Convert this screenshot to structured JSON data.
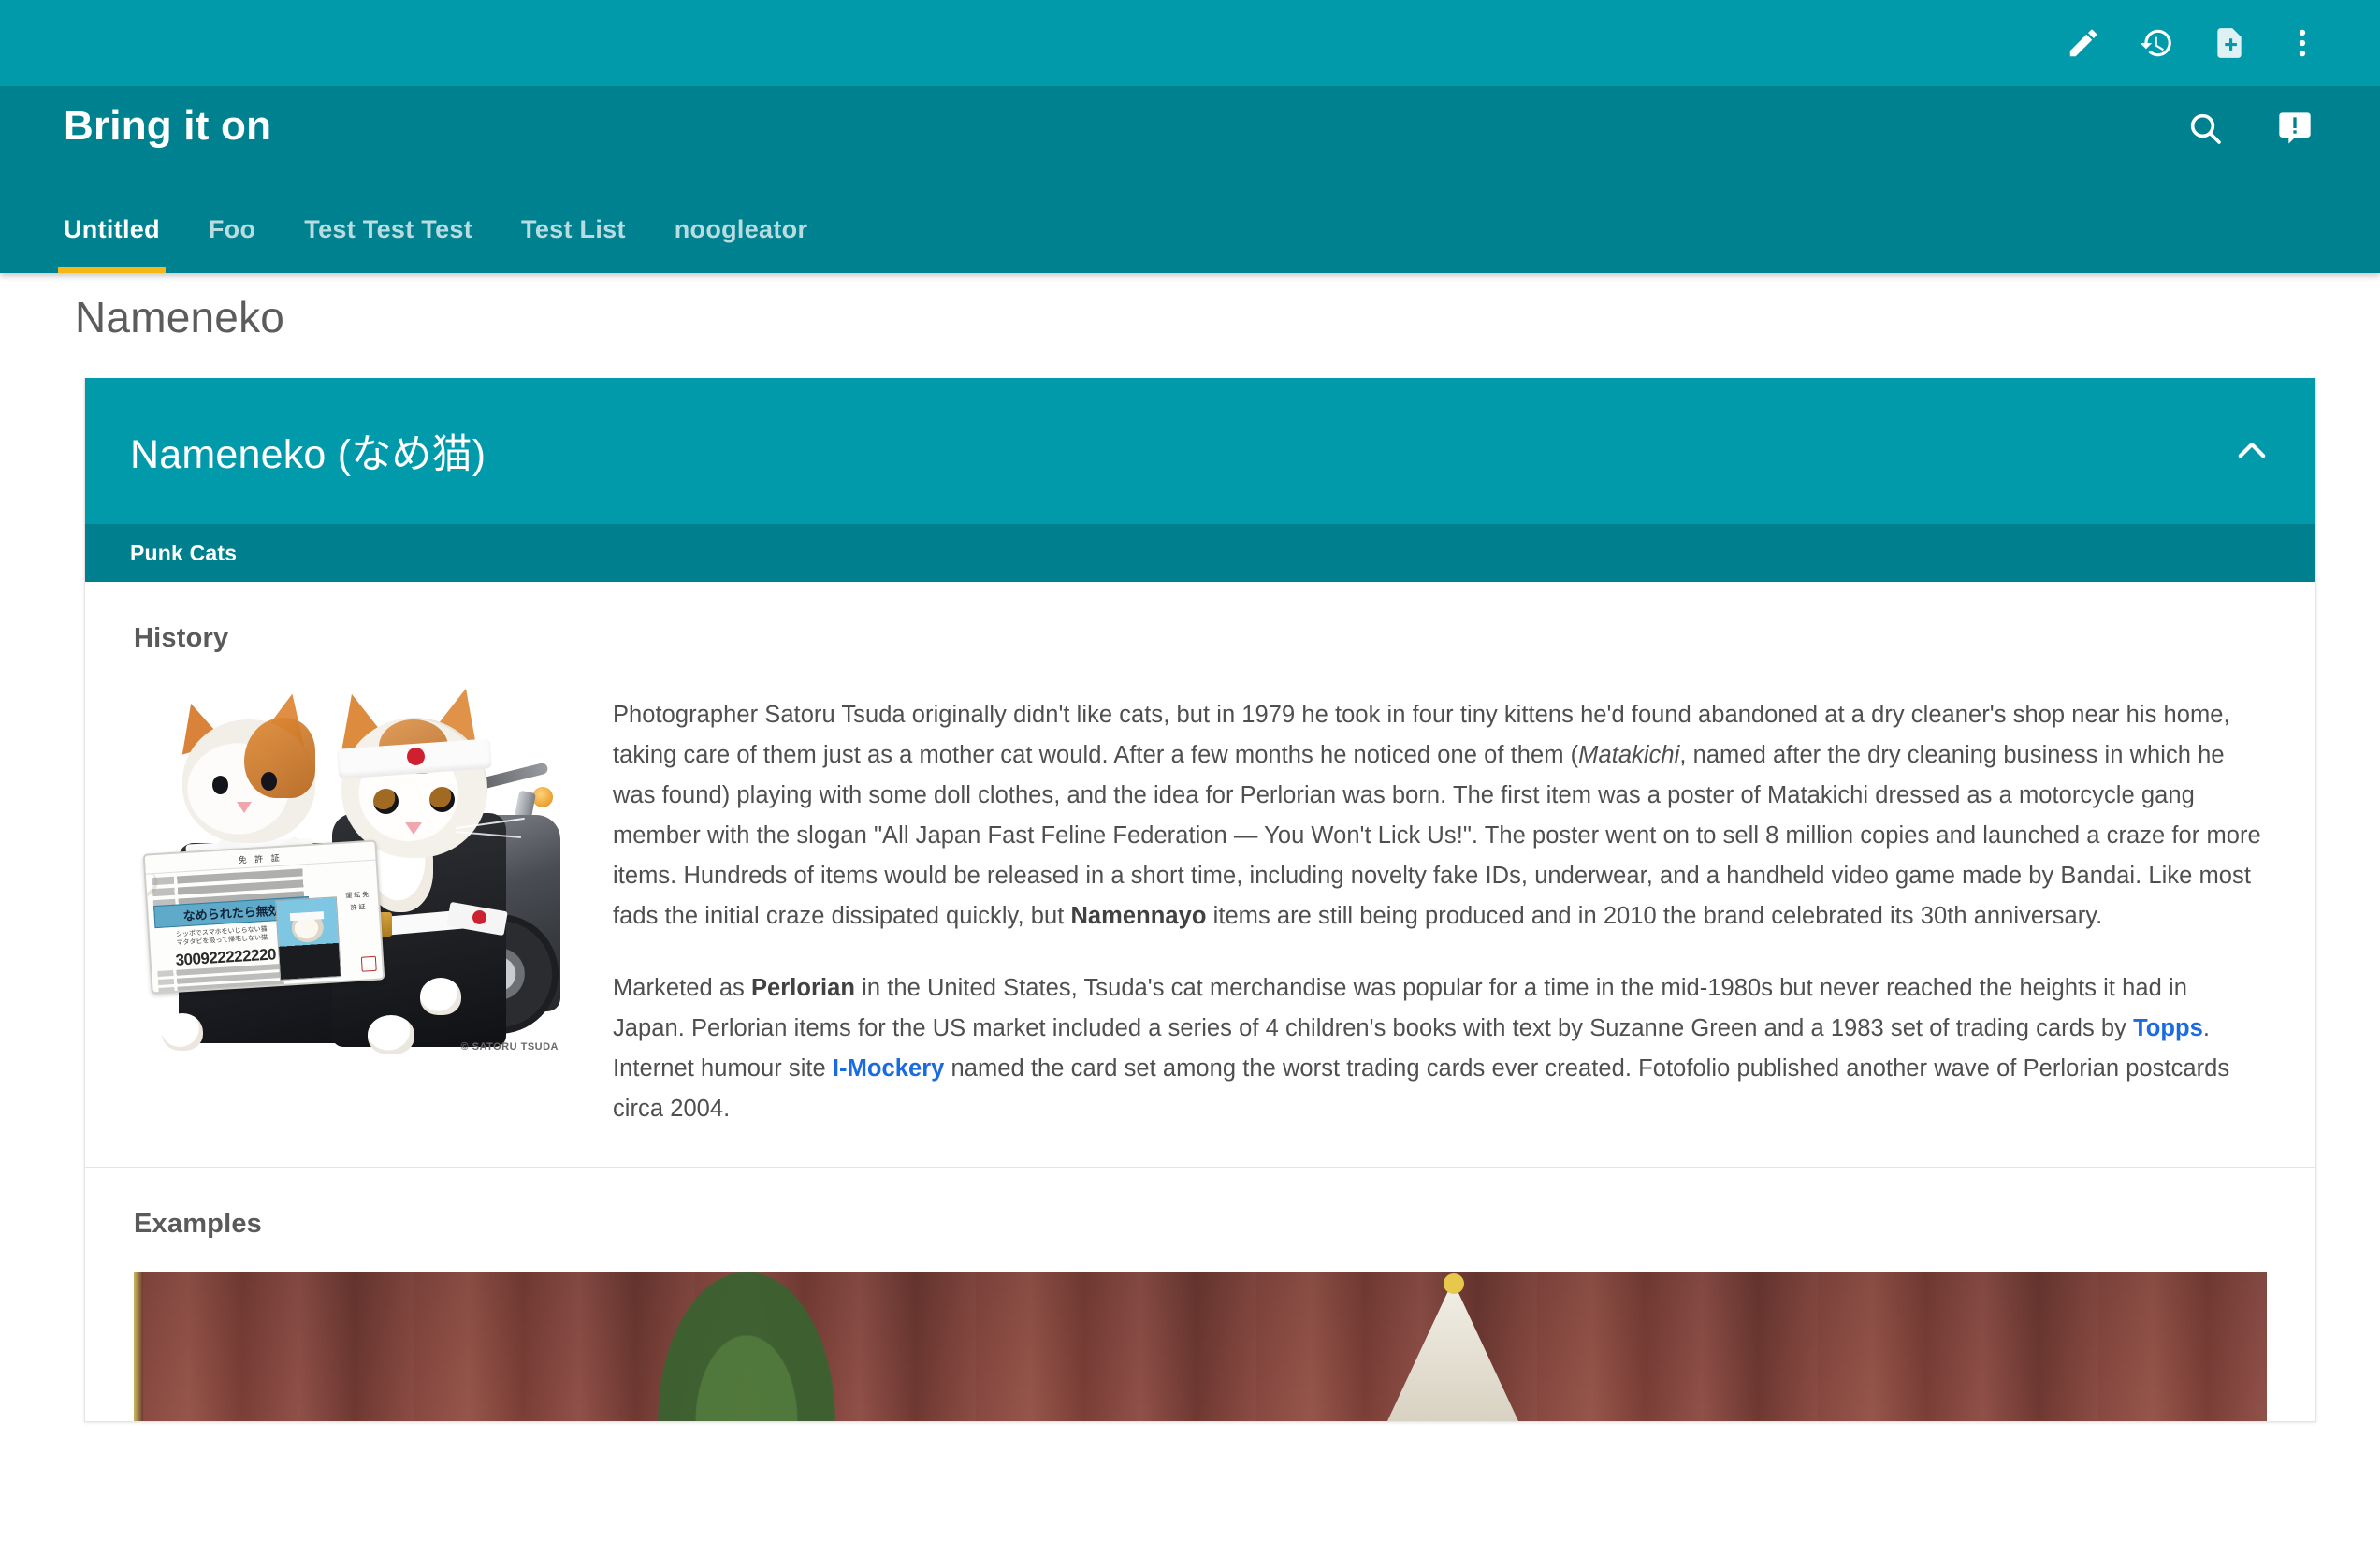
{
  "top_toolbar": {
    "buttons": [
      {
        "name": "edit-icon",
        "label": "Edit"
      },
      {
        "name": "history-icon",
        "label": "Revision history"
      },
      {
        "name": "new-document-icon",
        "label": "New document"
      },
      {
        "name": "more-options-icon",
        "label": "More options"
      }
    ]
  },
  "app_bar": {
    "title": "Bring it on",
    "actions": [
      {
        "name": "search-icon",
        "label": "Search"
      },
      {
        "name": "feedback-icon",
        "label": "Feedback"
      }
    ],
    "tabs": [
      {
        "label": "Untitled",
        "active": true
      },
      {
        "label": "Foo",
        "active": false
      },
      {
        "label": "Test Test Test",
        "active": false
      },
      {
        "label": "Test List",
        "active": false
      },
      {
        "label": "noogleator",
        "active": false
      }
    ]
  },
  "page": {
    "title": "Nameneko"
  },
  "card": {
    "title": "Nameneko (なめ猫)",
    "subtitle": "Punk Cats",
    "collapse_icon": "chevron-up-icon",
    "sections": [
      {
        "heading": "History"
      },
      {
        "heading": "Examples"
      }
    ]
  },
  "history": {
    "heading": "History",
    "paragraph1": {
      "part1": "Photographer Satoru Tsuda originally didn't like cats, but in 1979 he took in four tiny kittens he'd found abandoned at a dry cleaner's shop near his home, taking care of them just as a mother cat would. After a few months he noticed one of them (",
      "italic1": "Matakichi",
      "part2": ", named after the dry cleaning business in which he was found) playing with some doll clothes, and the idea for Perlorian was born. The first item was a poster of Matakichi dressed as a motorcycle gang member with the slogan \"All Japan Fast Feline Federation — You Won't Lick Us!\". The poster went on to sell 8 million copies and launched a craze for more items. Hundreds of items would be released in a short time, including novelty fake IDs, underwear, and a handheld video game made by Bandai. Like most fads the initial craze dissipated quickly, but ",
      "bold1": "Namennayo",
      "part3": " items are still being produced and in 2010 the brand celebrated its 30th anniversary."
    },
    "paragraph2": {
      "part1": "Marketed as ",
      "bold1": "Perlorian",
      "part2": " in the United States, Tsuda's cat merchandise was popular for a time in the mid-1980s but never reached the heights it had in Japan. Perlorian items for the US market included a series of 4 children's books with text by Suzanne Green and a 1983 set of trading cards by ",
      "link1": "Topps",
      "part3": ". Internet humour site ",
      "link2": "I-Mockery",
      "part4": " named the card set among the worst trading cards ever created. Fotofolio published another wave of Perlorian postcards circa 2004."
    }
  },
  "photo": {
    "credit": "© SATORU TSUDA",
    "license_card": {
      "top_label": "免 許 証",
      "blue_text": "なめられたら無効",
      "sub_line1": "シッポでスマホをいじらない猫",
      "sub_line2": "マタタビを吸って帰宅しない猫",
      "number": "300922222220",
      "side_text": "運 転 免 許 証"
    }
  },
  "examples": {
    "heading": "Examples"
  },
  "colors": {
    "toolbar_teal": "#009aab",
    "appbar_teal": "#00818f",
    "subbar_teal": "#00808e",
    "tab_indicator": "#f5b618",
    "link_blue": "#1a6be0",
    "body_text": "#4f4f4f",
    "heading_text": "#5a5a5a",
    "page_title": "#5c5c5c"
  }
}
